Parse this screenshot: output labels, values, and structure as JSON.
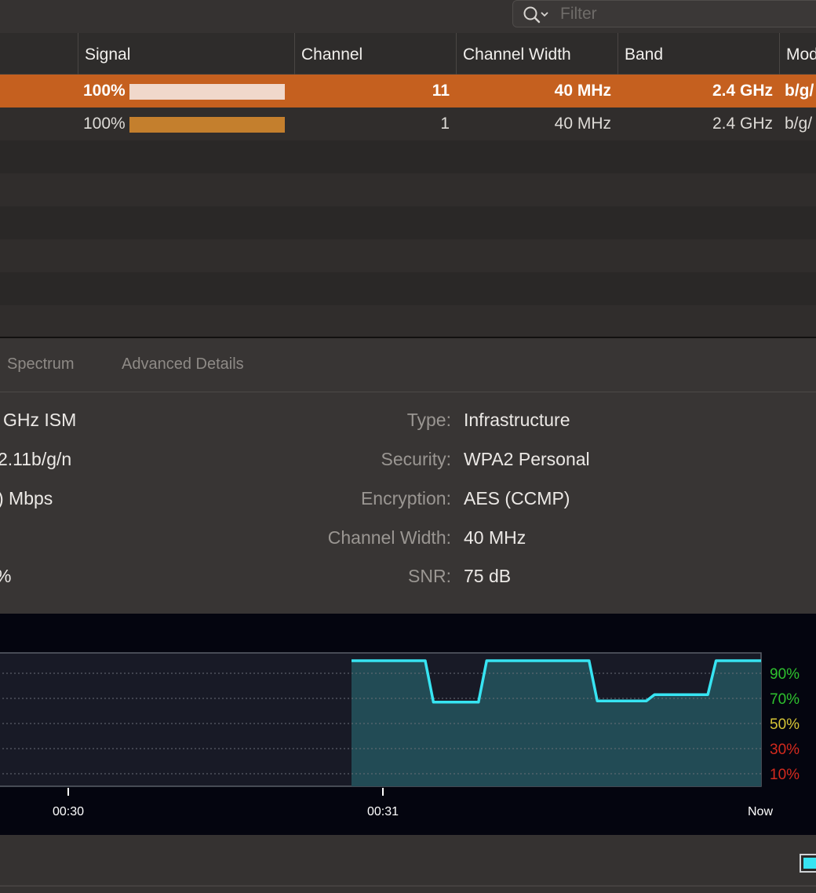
{
  "toolbar": {
    "filter_placeholder": "Filter"
  },
  "table": {
    "columns": [
      "Signal",
      "Channel",
      "Channel Width",
      "Band",
      "Mod"
    ],
    "rows": [
      {
        "signal": "100%",
        "signal_level": 1.0,
        "channel": "11",
        "width": "40 MHz",
        "band": "2.4 GHz",
        "mode": "b/g/",
        "selected": true
      },
      {
        "signal": "100%",
        "signal_level": 1.0,
        "channel": "1",
        "width": "40 MHz",
        "band": "2.4 GHz",
        "mode": "b/g/",
        "selected": false
      }
    ]
  },
  "colors": {
    "selection": "#c5601f",
    "signal_bar_selected": "#f0d8cb",
    "signal_bar": "#c47f2d",
    "graph_line": "#37e4f2",
    "good": "#2ec12e",
    "fair": "#d6c436",
    "poor": "#d42a1e"
  },
  "details": {
    "tabs": [
      "Spectrum",
      "Advanced Details"
    ],
    "left_values": [
      "GHz ISM",
      "2.11b/g/n",
      ") Mbps",
      "]",
      "%"
    ],
    "fields": [
      {
        "label": "Type:",
        "value": "Infrastructure"
      },
      {
        "label": "Security:",
        "value": "WPA2 Personal"
      },
      {
        "label": "Encryption:",
        "value": "AES (CCMP)"
      },
      {
        "label": "Channel Width:",
        "value": "40 MHz"
      },
      {
        "label": "SNR:",
        "value": "75 dB"
      }
    ]
  },
  "chart_data": {
    "type": "area",
    "title": "",
    "xlabel": "",
    "ylabel": "",
    "x_ticks": [
      "00:30",
      "00:31",
      "Now"
    ],
    "y_ticks": [
      {
        "label": "90%",
        "value": 90,
        "color": "good"
      },
      {
        "label": "70%",
        "value": 70,
        "color": "good"
      },
      {
        "label": "50%",
        "value": 50,
        "color": "fair"
      },
      {
        "label": "30%",
        "value": 30,
        "color": "poor"
      },
      {
        "label": "10%",
        "value": 10,
        "color": "poor"
      }
    ],
    "ylim": [
      0,
      105
    ],
    "grid": true,
    "series": [
      {
        "x": [
          0.0,
          0.18,
          0.2,
          0.31,
          0.33,
          0.58,
          0.6,
          0.72,
          0.74,
          0.87,
          0.89,
          1.0
        ],
        "values": [
          100,
          100,
          67,
          67,
          100,
          100,
          68,
          68,
          73,
          73,
          100,
          100
        ]
      }
    ]
  },
  "footer": {
    "legend_icon": "cyan-swatch-icon"
  }
}
